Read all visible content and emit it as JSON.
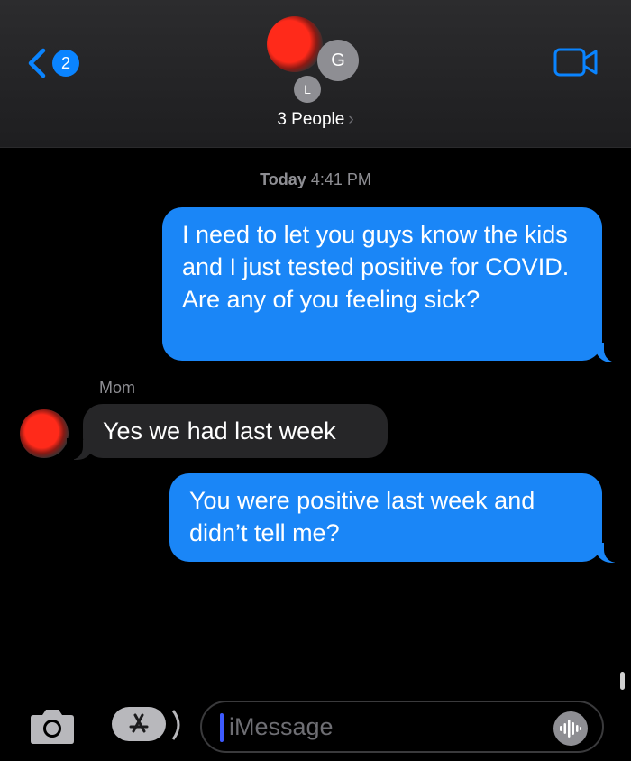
{
  "header": {
    "back_badge_count": "2",
    "avatar_g_initial": "G",
    "avatar_l_initial": "L",
    "group_title": "3 People",
    "group_chevron": "›"
  },
  "conversation": {
    "timestamp_day": "Today",
    "timestamp_time": "4:41 PM",
    "messages": [
      {
        "direction": "outgoing",
        "text": "I need to let you guys know the kids and I just tested positive for COVID. Are any of you feeling sick?"
      },
      {
        "direction": "incoming",
        "sender": "Mom",
        "text": "Yes we had last week"
      },
      {
        "direction": "outgoing",
        "text": "You were positive last week and didn’t tell me?"
      }
    ]
  },
  "input_bar": {
    "placeholder": "iMessage",
    "icons": [
      "camera-icon",
      "app-store-icon",
      "audio-waveform-icon"
    ]
  },
  "colors": {
    "accent": "#0a84ff",
    "outgoing_bubble": "#1a86f7",
    "incoming_bubble": "#262628",
    "background": "#000000"
  }
}
